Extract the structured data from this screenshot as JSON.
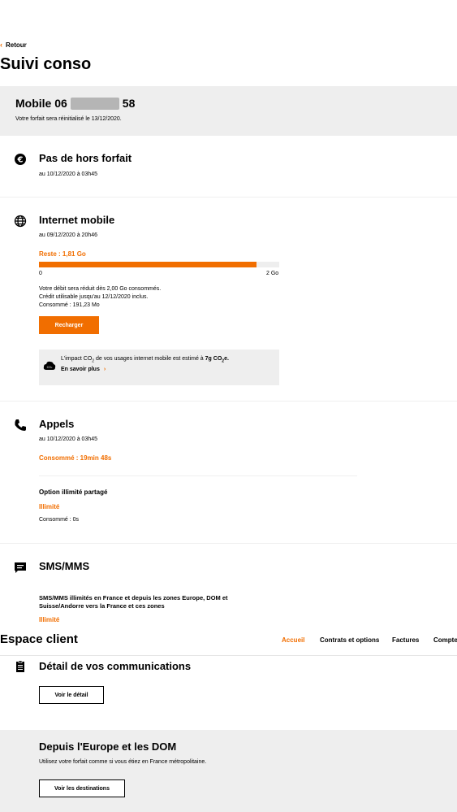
{
  "back": {
    "label": "Retour"
  },
  "page_title": "Suivi conso",
  "mobile": {
    "prefix": "Mobile 06",
    "suffix": "58",
    "reset_text": "Votre forfait sera réinitialisé le 13/12/2020."
  },
  "hors_forfait": {
    "title": "Pas de hors forfait",
    "date": "au 10/12/2020 à 03h45"
  },
  "internet": {
    "title": "Internet mobile",
    "date": "au 09/12/2020 à 20h46",
    "remaining": "Reste : 1,81 Go",
    "usage_fraction": 0.905,
    "scale_min": "0",
    "scale_max": "2 Go",
    "info_1": "Votre débit sera réduit dès 2,00 Go consommés.",
    "info_2": "Crédit utilisable jusqu'au 12/12/2020 inclus.",
    "info_3": "Consommé : 191,23 Mo",
    "recharge_label": "Recharger",
    "eco_prefix": "L'impact CO",
    "eco_sub": "2",
    "eco_middle": " de vos usages internet mobile est estimé à ",
    "eco_value": "7g CO",
    "eco_value_sub": "2",
    "eco_value_end": "e.",
    "eco_link": "En savoir plus",
    "eco_icon_text": "CO₂"
  },
  "appels": {
    "title": "Appels",
    "date": "au 10/12/2020 à 03h45",
    "consumed": "Consommé : 19min 48s",
    "option_title": "Option illimité partagé",
    "option_status": "Illimité",
    "option_consumed": "Consommé : 0s"
  },
  "sms": {
    "title": "SMS/MMS",
    "desc_1": "SMS/MMS illimités en France et depuis les zones Europe, DOM et",
    "desc_2": "Suisse/Andorre vers la France et ces zones",
    "status": "Illimité"
  },
  "espace_client": {
    "title": "Espace client",
    "tabs": [
      "Accueil",
      "Contrats et options",
      "Factures",
      "Compte"
    ]
  },
  "detail": {
    "title": "Détail de vos communications",
    "button": "Voir le détail"
  },
  "europe": {
    "title": "Depuis l'Europe et les DOM",
    "desc": "Utilisez votre forfait comme si vous étiez en France métropolitaine.",
    "button": "Voir les destinations"
  },
  "colors": {
    "accent": "#f16e00",
    "band": "#eeeeee"
  }
}
